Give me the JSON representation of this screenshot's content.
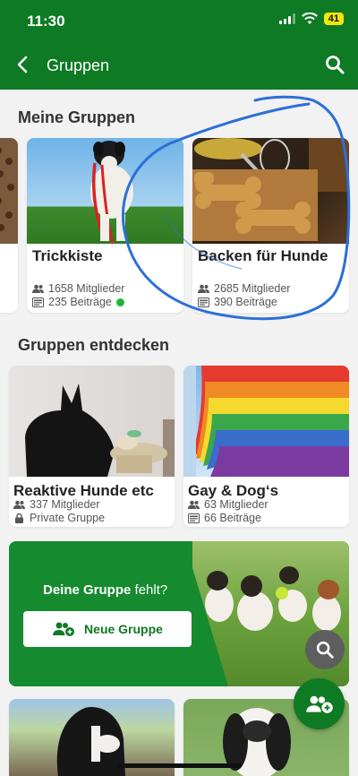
{
  "status": {
    "time": "11:30",
    "battery": "41"
  },
  "header": {
    "title": "Gruppen"
  },
  "my_groups": {
    "title": "Meine Gruppen",
    "cards": [
      {
        "name": "Trickkiste",
        "members": "1658 Mitglieder",
        "posts": "235 Beiträge"
      },
      {
        "name": "Backen für Hunde",
        "members": "2685 Mitglieder",
        "posts": "390 Beiträge"
      }
    ]
  },
  "discover": {
    "title": "Gruppen entdecken",
    "cards": [
      {
        "name": "Reaktive Hunde etc",
        "members": "337 Mitglieder",
        "privacy": "Private Gruppe"
      },
      {
        "name": "Gay & Dog‘s",
        "members": "63 Mitglieder",
        "posts": "66 Beiträge"
      }
    ]
  },
  "banner": {
    "text_part1": "Deine Gruppe",
    "text_part2": " fehlt?",
    "button_label": "Neue Gruppe"
  },
  "colors": {
    "brand_green": "#0e7a24",
    "online_dot": "#21b53c"
  }
}
